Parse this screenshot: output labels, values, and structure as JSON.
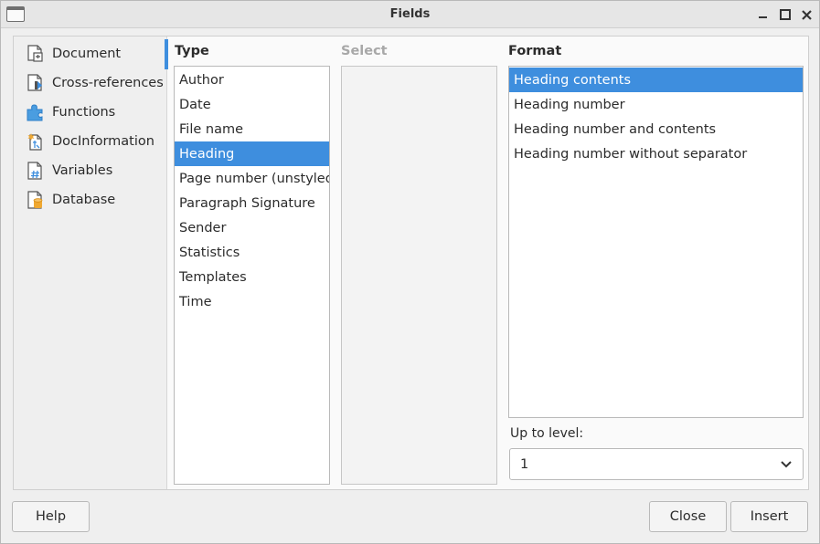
{
  "window": {
    "title": "Fields"
  },
  "sidebar": {
    "items": [
      {
        "label": "Document",
        "icon": "document-icon"
      },
      {
        "label": "Cross-references",
        "icon": "cross-reference-icon"
      },
      {
        "label": "Functions",
        "icon": "puzzle-icon"
      },
      {
        "label": "DocInformation",
        "icon": "doc-info-icon"
      },
      {
        "label": "Variables",
        "icon": "variable-icon"
      },
      {
        "label": "Database",
        "icon": "database-icon"
      }
    ],
    "active_index": 0
  },
  "type_column": {
    "header": "Type",
    "items": [
      "Author",
      "Date",
      "File name",
      "Heading",
      "Page number (unstyled)",
      "Paragraph Signature",
      "Sender",
      "Statistics",
      "Templates",
      "Time"
    ],
    "selected": "Heading"
  },
  "select_column": {
    "header": "Select",
    "items": []
  },
  "format_column": {
    "header": "Format",
    "items": [
      "Heading contents",
      "Heading number",
      "Heading number and contents",
      "Heading number without separator"
    ],
    "selected": "Heading contents"
  },
  "level": {
    "label": "Up to level:",
    "value": "1"
  },
  "buttons": {
    "help": "Help",
    "close": "Close",
    "insert": "Insert"
  },
  "colors": {
    "accent": "#3e8ede",
    "selection_text": "#ffffff",
    "document_icon": "#5a5a5a",
    "functions_icon": "#3e8ede",
    "database_icon": "#f0a830"
  }
}
